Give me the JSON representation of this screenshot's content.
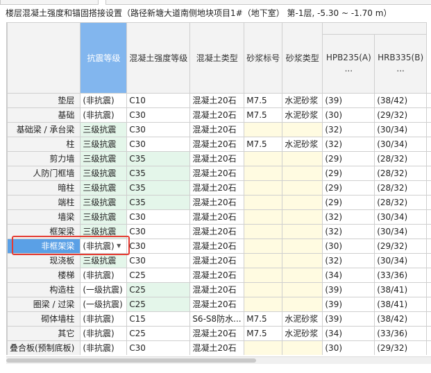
{
  "title": "楼层混凝土强度和锚固搭接设置（路径新塘大道南侧地块项目1#（地下室）  第-1层, -5.30 ~ -1.70 m）",
  "columns": [
    "抗震等级",
    "混凝土强度等级",
    "混凝土类型",
    "砂浆标号",
    "砂浆类型",
    "HPB235(A)\n...",
    "HRB335(B)\n..."
  ],
  "colors": {
    "selected_header": "#82b6ee",
    "active_row": "#5aa0e6",
    "seismic_fill": "#e4f6ea",
    "mortar_fill": "#fffbe1",
    "highlight_border": "#e53b32"
  },
  "rows": [
    {
      "name": "垫层",
      "seismic": "(非抗震)",
      "grade": "C10",
      "concrete": "混凝土20石",
      "mortar_grade": "M7.5",
      "mortar_type": "水泥砂浆",
      "hpb": "(39)",
      "hrb": "(38/42)"
    },
    {
      "name": "基础",
      "seismic": "(非抗震)",
      "grade": "C30",
      "concrete": "混凝土20石",
      "mortar_grade": "M7.5",
      "mortar_type": "水泥砂浆",
      "hpb": "(30)",
      "hrb": "(29/32)"
    },
    {
      "name": "基础梁 / 承台梁",
      "seismic": "三级抗震",
      "grade": "C30",
      "concrete": "混凝土20石",
      "mortar_grade": "",
      "mortar_type": "",
      "hpb": "(32)",
      "hrb": "(30/34)"
    },
    {
      "name": "柱",
      "seismic": "三级抗震",
      "grade": "C30",
      "concrete": "混凝土20石",
      "mortar_grade": "M7.5",
      "mortar_type": "水泥砂浆",
      "hpb": "(32)",
      "hrb": "(30/34)"
    },
    {
      "name": "剪力墙",
      "seismic": "三级抗震",
      "grade": "C35",
      "concrete": "混凝土20石",
      "mortar_grade": "",
      "mortar_type": "",
      "hpb": "(29)",
      "hrb": "(28/32)"
    },
    {
      "name": "人防门框墙",
      "seismic": "三级抗震",
      "grade": "C35",
      "concrete": "混凝土20石",
      "mortar_grade": "",
      "mortar_type": "",
      "hpb": "(29)",
      "hrb": "(28/32)"
    },
    {
      "name": "暗柱",
      "seismic": "三级抗震",
      "grade": "C35",
      "concrete": "混凝土20石",
      "mortar_grade": "",
      "mortar_type": "",
      "hpb": "(29)",
      "hrb": "(28/32)"
    },
    {
      "name": "端柱",
      "seismic": "三级抗震",
      "grade": "C35",
      "concrete": "混凝土20石",
      "mortar_grade": "",
      "mortar_type": "",
      "hpb": "(29)",
      "hrb": "(28/32)"
    },
    {
      "name": "墙梁",
      "seismic": "三级抗震",
      "grade": "C30",
      "concrete": "混凝土20石",
      "mortar_grade": "",
      "mortar_type": "",
      "hpb": "(32)",
      "hrb": "(30/34)"
    },
    {
      "name": "框架梁",
      "seismic": "三级抗震",
      "grade": "C30",
      "concrete": "混凝土20石",
      "mortar_grade": "",
      "mortar_type": "",
      "hpb": "(32)",
      "hrb": "(30/34)"
    },
    {
      "name": "非框架梁",
      "seismic": "(非抗震)",
      "grade": "C30",
      "concrete": "混凝土20石",
      "mortar_grade": "",
      "mortar_type": "",
      "hpb": "(30)",
      "hrb": "(29/32)"
    },
    {
      "name": "现浇板",
      "seismic": "三级抗震",
      "grade": "C30",
      "concrete": "混凝土20石",
      "mortar_grade": "",
      "mortar_type": "",
      "hpb": "(32)",
      "hrb": "(30/34)"
    },
    {
      "name": "楼梯",
      "seismic": "(非抗震)",
      "grade": "C25",
      "concrete": "混凝土20石",
      "mortar_grade": "",
      "mortar_type": "",
      "hpb": "(34)",
      "hrb": "(33/36)"
    },
    {
      "name": "构造柱",
      "seismic": "(一级抗震)",
      "grade": "C25",
      "concrete": "混凝土20石",
      "mortar_grade": "",
      "mortar_type": "",
      "hpb": "(39)",
      "hrb": "(38/41)"
    },
    {
      "name": "圈梁 / 过梁",
      "seismic": "(一级抗震)",
      "grade": "C25",
      "concrete": "混凝土20石",
      "mortar_grade": "",
      "mortar_type": "",
      "hpb": "(39)",
      "hrb": "(38/41)"
    },
    {
      "name": "砌体墙柱",
      "seismic": "(非抗震)",
      "grade": "C15",
      "concrete": "S6-S8防水...",
      "mortar_grade": "M7.5",
      "mortar_type": "水泥砂浆",
      "hpb": "(39)",
      "hrb": "(38/42)"
    },
    {
      "name": "其它",
      "seismic": "(非抗震)",
      "grade": "C25",
      "concrete": "混凝土20石",
      "mortar_grade": "M7.5",
      "mortar_type": "水泥砂浆",
      "hpb": "(34)",
      "hrb": "(33/36)"
    },
    {
      "name": "叠合板(预制底板)",
      "seismic": "(非抗震)",
      "grade": "C30",
      "concrete": "混凝土20石",
      "mortar_grade": "",
      "mortar_type": "",
      "hpb": "(30)",
      "hrb": "(29/32)"
    }
  ],
  "seismic_highlight": [
    2,
    3,
    4,
    5,
    6,
    7,
    8,
    9,
    11
  ],
  "grade_highlight": [
    4,
    5,
    6,
    7,
    13,
    14
  ],
  "mortar_highlight": [
    2,
    4,
    5,
    6,
    7,
    8,
    9,
    10,
    11,
    12,
    13,
    14,
    17
  ],
  "active_row": 10,
  "dropdown_row": 10
}
